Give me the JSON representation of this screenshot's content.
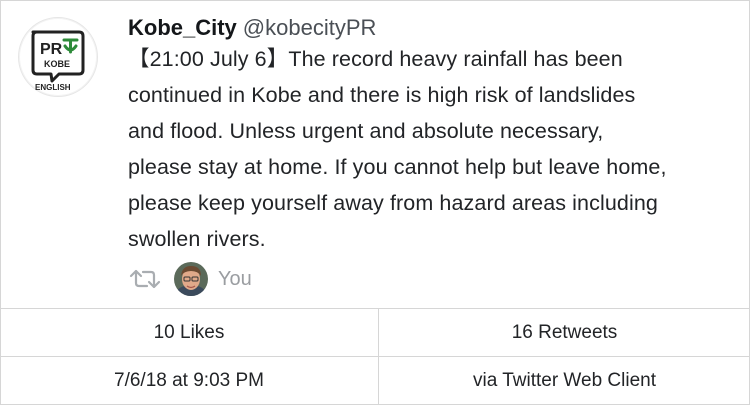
{
  "tweet": {
    "display_name": "Kobe_City",
    "handle": "@kobecityPR",
    "text_lines": [
      "【21:00 July 6】The record heavy rainfall has been",
      "continued in Kobe and there is high risk of landslides",
      "and flood. Unless urgent and absolute necessary,",
      "please stay at home. If you cannot help but leave home,",
      "please keep yourself away from hazard areas including",
      "swollen rivers."
    ]
  },
  "avatar": {
    "logo_top": "PR",
    "logo_mid": "KOBE",
    "logo_bottom": "ENGLISH",
    "icon": "pr-kobe-logo-icon"
  },
  "actions": {
    "retweet_icon": "retweet-icon",
    "retweeted_by": "You"
  },
  "stats": {
    "likes": "10 Likes",
    "retweets": "16 Retweets",
    "timestamp": "7/6/18 at 9:03 PM",
    "source": "via Twitter Web Client"
  },
  "colors": {
    "logo_green": "#2e8b3a",
    "border": "#d6d6d6",
    "muted": "#9a9da1"
  }
}
